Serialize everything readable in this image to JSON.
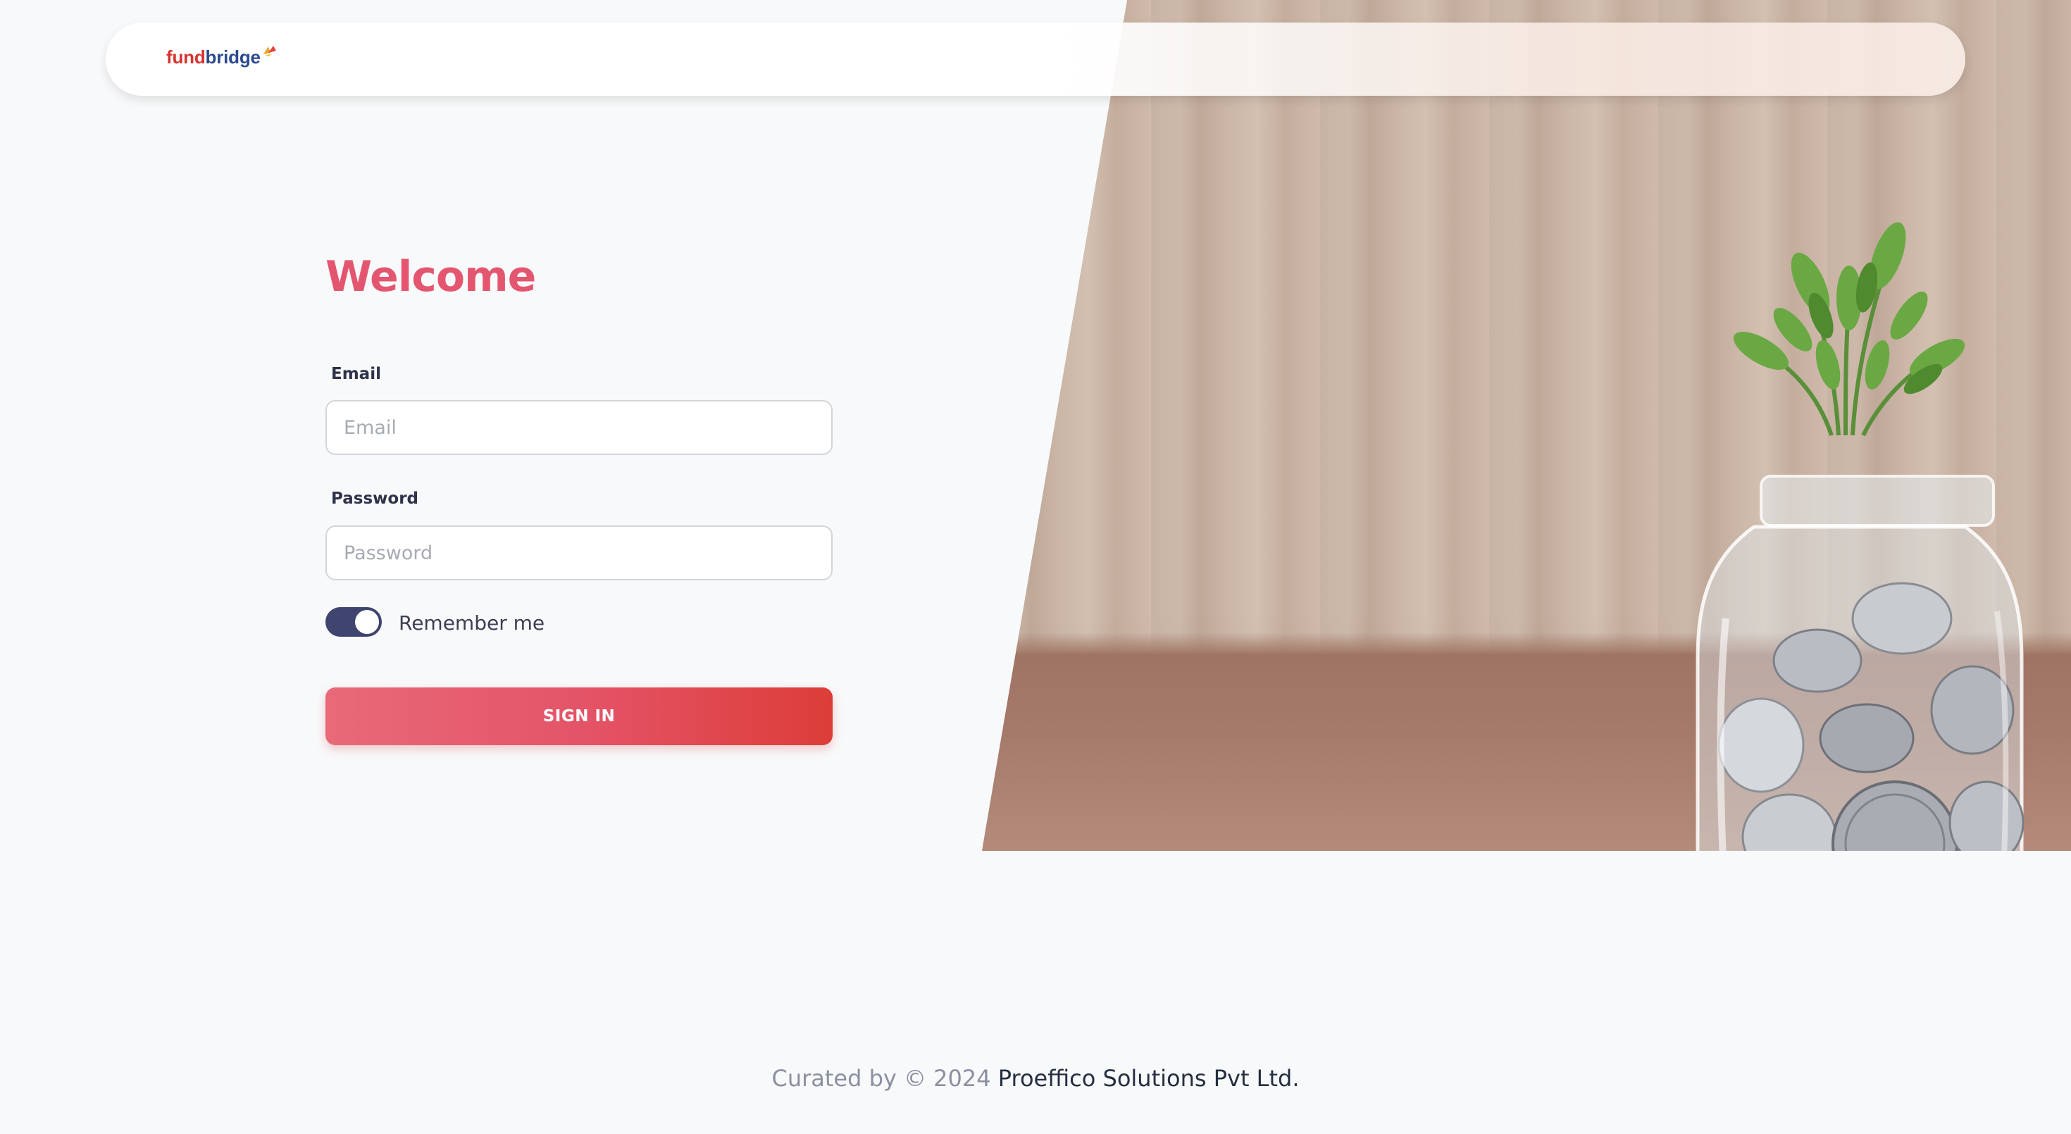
{
  "header": {
    "logo_part1": "fund",
    "logo_part2": "bridge"
  },
  "form": {
    "title": "Welcome",
    "email_label": "Email",
    "email_placeholder": "Email",
    "email_value": "",
    "password_label": "Password",
    "password_placeholder": "Password",
    "password_value": "",
    "remember_label": "Remember me",
    "remember_checked": true,
    "submit_label": "SIGN IN"
  },
  "footer": {
    "prefix": "Curated by © 2024",
    "company": "Proeffico Solutions Pvt Ltd."
  },
  "colors": {
    "accent": "#e4566f",
    "toggle_on": "#3f456e",
    "logo_red": "#d6342e",
    "logo_blue": "#2c4a8f"
  },
  "icons": {
    "logo_mark": "leaf-spark-icon",
    "hero": "coin-jar-plant-image"
  }
}
